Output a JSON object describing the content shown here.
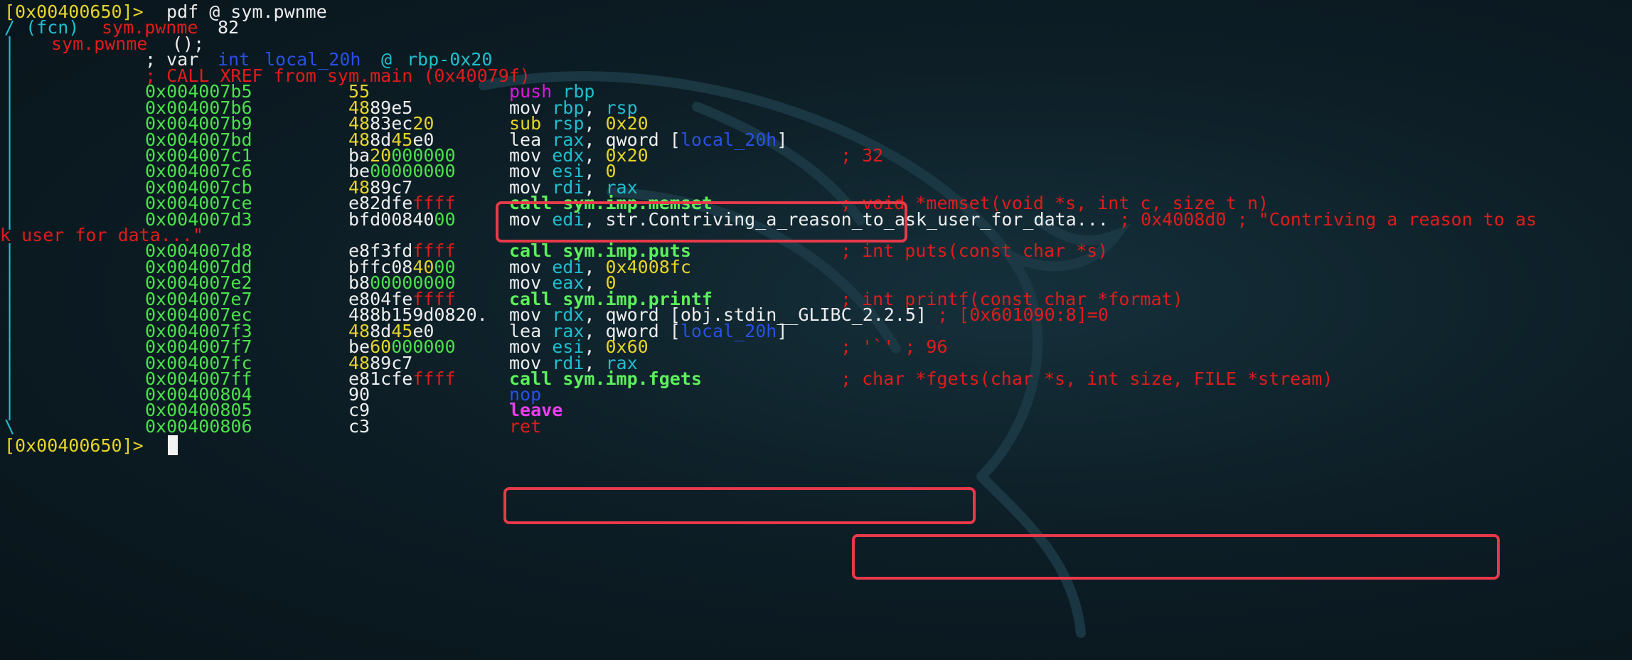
{
  "prompt": "[0x00400650]>",
  "command": "pdf @ sym.pwnme",
  "header": {
    "fcn_tag": "/ (fcn)",
    "fcn_name": "sym.pwnme",
    "fcn_size": "82",
    "sig_name": "sym.pwnme",
    "sig_args": "();",
    "var_prefix": "; var",
    "var_type": "int",
    "var_name": "local_20h",
    "var_at": "@",
    "var_loc": "rbp-0x20",
    "xref": "; CALL XREF from sym.main (0x40079f)"
  },
  "gutter": {
    "vbar": "|",
    "end": "\\"
  },
  "rows": [
    {
      "addr": "0x004007b5",
      "bytes": [
        [
          "55",
          "y"
        ]
      ],
      "asm": [
        [
          "push",
          "m"
        ],
        [
          " rbp",
          "c"
        ]
      ],
      "comment": []
    },
    {
      "addr": "0x004007b6",
      "bytes": [
        [
          "48",
          "y"
        ],
        [
          "89e5",
          "w"
        ]
      ],
      "asm": [
        [
          "mov ",
          "w"
        ],
        [
          "rbp",
          "c"
        ],
        [
          ", ",
          "w"
        ],
        [
          "rsp",
          "c"
        ]
      ],
      "comment": []
    },
    {
      "addr": "0x004007b9",
      "bytes": [
        [
          "48",
          "y"
        ],
        [
          "83ec",
          "w"
        ],
        [
          "20",
          "y"
        ]
      ],
      "asm": [
        [
          "sub ",
          "y"
        ],
        [
          "rsp",
          "c"
        ],
        [
          ", ",
          "w"
        ],
        [
          "0x20",
          "y"
        ]
      ],
      "comment": []
    },
    {
      "addr": "0x004007bd",
      "bytes": [
        [
          "48",
          "y"
        ],
        [
          "8d",
          "w"
        ],
        [
          "45",
          "y"
        ],
        [
          "e0",
          "w"
        ]
      ],
      "asm": [
        [
          "lea ",
          "w"
        ],
        [
          "rax",
          "c"
        ],
        [
          ", qword [",
          "w"
        ],
        [
          "local_20h",
          "b"
        ],
        [
          "]",
          "w"
        ]
      ],
      "comment": []
    },
    {
      "addr": "0x004007c1",
      "bytes": [
        [
          "ba",
          "w"
        ],
        [
          "20",
          "y"
        ],
        [
          "000000",
          "g"
        ]
      ],
      "asm": [
        [
          "mov ",
          "w"
        ],
        [
          "edx",
          "c"
        ],
        [
          ", ",
          "w"
        ],
        [
          "0x20",
          "y"
        ]
      ],
      "comment": [
        [
          "; 32",
          "r"
        ]
      ]
    },
    {
      "addr": "0x004007c6",
      "bytes": [
        [
          "be",
          "w"
        ],
        [
          "00000000",
          "g"
        ]
      ],
      "asm": [
        [
          "mov ",
          "w"
        ],
        [
          "esi",
          "c"
        ],
        [
          ", ",
          "w"
        ],
        [
          "0",
          "y"
        ]
      ],
      "comment": []
    },
    {
      "addr": "0x004007cb",
      "bytes": [
        [
          "48",
          "y"
        ],
        [
          "89c7",
          "w"
        ]
      ],
      "asm": [
        [
          "mov ",
          "w"
        ],
        [
          "rdi",
          "c"
        ],
        [
          ", ",
          "w"
        ],
        [
          "rax",
          "c"
        ]
      ],
      "comment": []
    },
    {
      "addr": "0x004007ce",
      "bytes": [
        [
          "e82dfe",
          "w"
        ],
        [
          "ffff",
          "r"
        ]
      ],
      "asm": [
        [
          "call sym.imp.memset",
          "G"
        ]
      ],
      "comment": [
        [
          "; void *memset(void *s, int c, size_t n)",
          "r"
        ]
      ]
    },
    {
      "addr": "0x004007d3",
      "bytes": [
        [
          "bfd00840",
          "w"
        ],
        [
          "00",
          "g"
        ]
      ],
      "asm": [
        [
          "mov ",
          "w"
        ],
        [
          "edi",
          "c"
        ],
        [
          ", str.Contriving_a_reason_to_ask_user_for_data...",
          "w"
        ],
        [
          " ; 0x4008d0 ; \"Contriving a reason to as",
          "r"
        ]
      ],
      "comment": []
    },
    {
      "wrap": "k user for data...\""
    },
    {
      "addr": "0x004007d8",
      "bytes": [
        [
          "e8f3fd",
          "w"
        ],
        [
          "ffff",
          "r"
        ]
      ],
      "asm": [
        [
          "call sym.imp.puts",
          "G"
        ]
      ],
      "comment": [
        [
          "; int puts(const char *s)",
          "r"
        ]
      ]
    },
    {
      "addr": "0x004007dd",
      "bytes": [
        [
          "bffc08",
          "w"
        ],
        [
          "40",
          "y"
        ],
        [
          "00",
          "g"
        ]
      ],
      "asm": [
        [
          "mov ",
          "w"
        ],
        [
          "edi",
          "c"
        ],
        [
          ", ",
          "w"
        ],
        [
          "0x4008fc",
          "y"
        ]
      ],
      "comment": []
    },
    {
      "addr": "0x004007e2",
      "bytes": [
        [
          "b8",
          "w"
        ],
        [
          "00000000",
          "g"
        ]
      ],
      "asm": [
        [
          "mov ",
          "w"
        ],
        [
          "eax",
          "c"
        ],
        [
          ", ",
          "w"
        ],
        [
          "0",
          "y"
        ]
      ],
      "comment": []
    },
    {
      "addr": "0x004007e7",
      "bytes": [
        [
          "e804fe",
          "w"
        ],
        [
          "ffff",
          "r"
        ]
      ],
      "asm": [
        [
          "call sym.imp.printf",
          "G"
        ]
      ],
      "comment": [
        [
          "; int printf(const char *format)",
          "r"
        ]
      ]
    },
    {
      "addr": "0x004007ec",
      "bytes": [
        [
          "488b159d0820.",
          "w"
        ]
      ],
      "asm": [
        [
          "mov ",
          "w"
        ],
        [
          "rdx",
          "c"
        ],
        [
          ", qword [obj.stdin__GLIBC_2.2.5]",
          "w"
        ],
        [
          " ; [0x601090:8]=0",
          "r"
        ]
      ],
      "comment": []
    },
    {
      "addr": "0x004007f3",
      "bytes": [
        [
          "48",
          "y"
        ],
        [
          "8d",
          "w"
        ],
        [
          "45",
          "y"
        ],
        [
          "e0",
          "w"
        ]
      ],
      "asm": [
        [
          "lea ",
          "w"
        ],
        [
          "rax",
          "c"
        ],
        [
          ", qword [",
          "w"
        ],
        [
          "local_20h",
          "b"
        ],
        [
          "]",
          "w"
        ]
      ],
      "comment": []
    },
    {
      "addr": "0x004007f7",
      "bytes": [
        [
          "be",
          "w"
        ],
        [
          "60",
          "y"
        ],
        [
          "000000",
          "g"
        ]
      ],
      "asm": [
        [
          "mov ",
          "w"
        ],
        [
          "esi",
          "c"
        ],
        [
          ", ",
          "w"
        ],
        [
          "0x60",
          "y"
        ]
      ],
      "comment": [
        [
          "; '`' ; 96",
          "r"
        ]
      ]
    },
    {
      "addr": "0x004007fc",
      "bytes": [
        [
          "48",
          "y"
        ],
        [
          "89c7",
          "w"
        ]
      ],
      "asm": [
        [
          "mov ",
          "w"
        ],
        [
          "rdi",
          "c"
        ],
        [
          ", ",
          "w"
        ],
        [
          "rax",
          "c"
        ]
      ],
      "comment": []
    },
    {
      "addr": "0x004007ff",
      "bytes": [
        [
          "e81cfe",
          "w"
        ],
        [
          "ffff",
          "r"
        ]
      ],
      "asm": [
        [
          "call sym.imp.fgets",
          "G"
        ]
      ],
      "comment": [
        [
          ";",
          "r"
        ],
        [
          " char *fgets(char *s, int size, FILE *stream)",
          "r"
        ]
      ]
    },
    {
      "addr": "0x00400804",
      "bytes": [
        [
          "90",
          "w"
        ]
      ],
      "asm": [
        [
          "nop",
          "b"
        ]
      ],
      "comment": []
    },
    {
      "addr": "0x00400805",
      "bytes": [
        [
          "c9",
          "w"
        ]
      ],
      "asm": [
        [
          "leave",
          "M"
        ]
      ],
      "comment": []
    },
    {
      "addr": "0x00400806",
      "bytes": [
        [
          "c3",
          "w"
        ]
      ],
      "asm": [
        [
          "ret",
          "r"
        ]
      ],
      "comment": []
    }
  ],
  "colors": {
    "background": "#0d1e26",
    "prompt": "#e6d42a",
    "address": "#4ce04c",
    "comment": "#e01c1c",
    "register": "#1fbfcf",
    "highlight_box": "#e8394a"
  }
}
